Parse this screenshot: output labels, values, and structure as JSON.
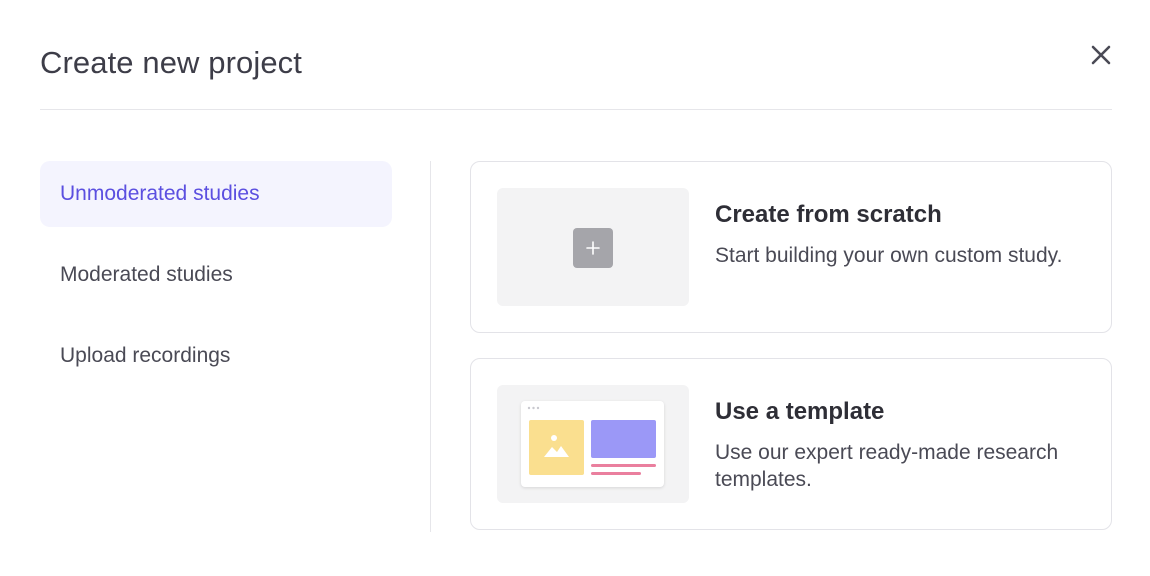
{
  "dialog": {
    "title": "Create new project",
    "close_icon": "close-icon"
  },
  "sidebar": {
    "items": [
      {
        "label": "Unmoderated studies",
        "active": true
      },
      {
        "label": "Moderated studies",
        "active": false
      },
      {
        "label": "Upload recordings",
        "active": false
      }
    ]
  },
  "options": [
    {
      "title": "Create from scratch",
      "description": "Start building your own custom study.",
      "icon": "plus-icon"
    },
    {
      "title": "Use a template",
      "description": "Use our expert ready-made research templates.",
      "icon": "template-illustration-icon"
    }
  ],
  "colors": {
    "accent": "#5b4fe0",
    "active_bg": "#f4f4fe",
    "template_yellow": "#fadf8f",
    "template_purple": "#9b98f7",
    "template_pink": "#ea7f9e"
  }
}
